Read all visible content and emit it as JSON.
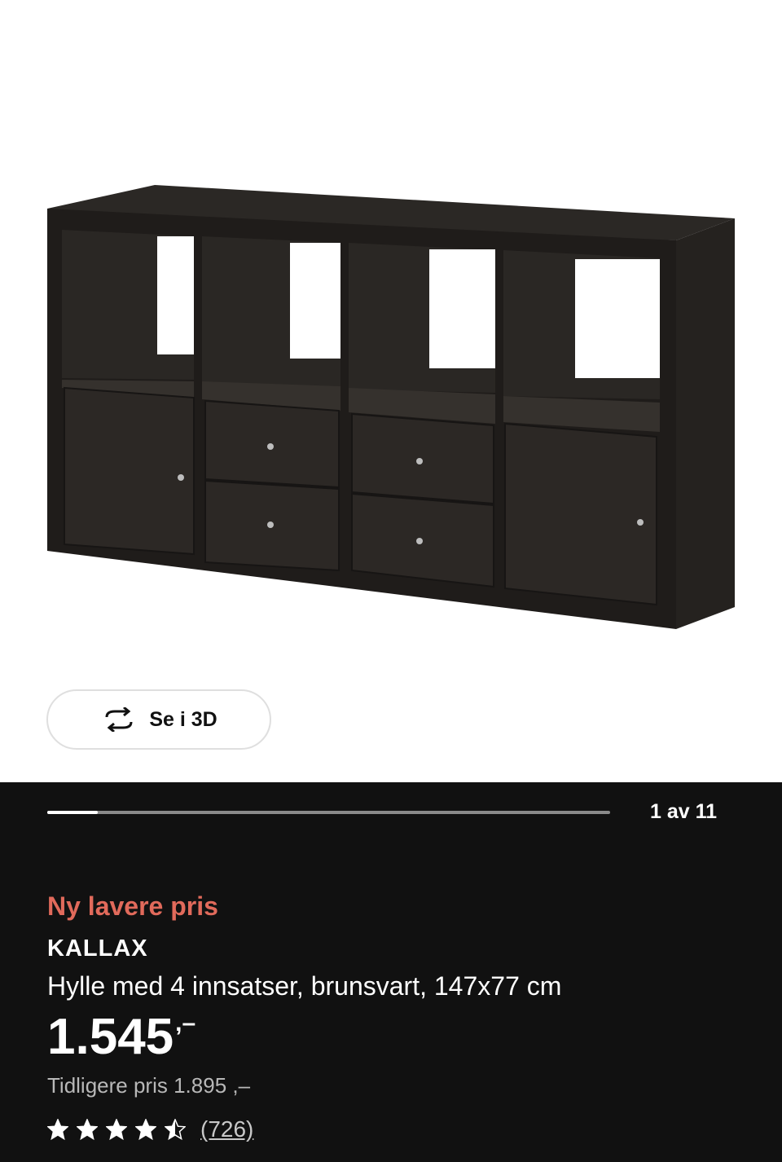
{
  "view3d": {
    "label": "Se i 3D",
    "icon": "rotate-3d-icon"
  },
  "gallery": {
    "counter": "1 av 11",
    "progress_fraction": 0.09
  },
  "product": {
    "badge": "Ny lavere pris",
    "badge_color": "#e16a5b",
    "name": "KALLAX",
    "description": "Hylle med 4 innsatser, brunsvart, 147x77 cm",
    "price_main": "1.545",
    "price_suffix": ",–",
    "previous_price": "Tidligere pris 1.895 ,–",
    "rating": 4.5,
    "review_count": "(726)"
  }
}
